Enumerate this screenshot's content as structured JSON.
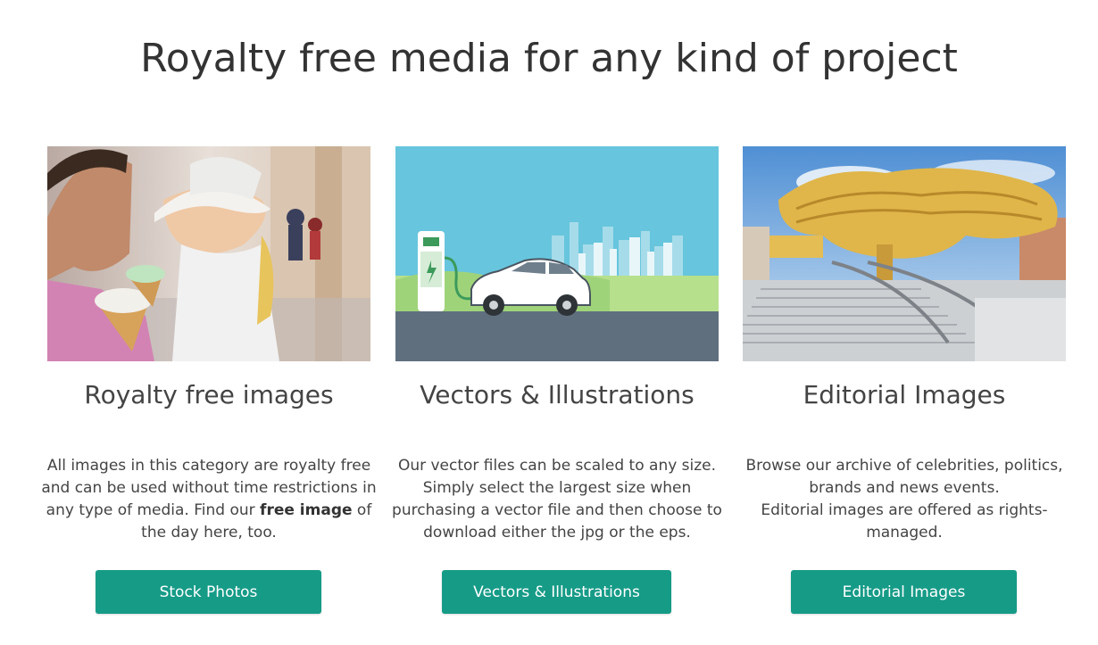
{
  "page": {
    "title": "Royalty free media for any kind of project"
  },
  "cards": [
    {
      "image_subject": "smiling couple holding ice cream cones",
      "title": "Royalty free images",
      "description_before": "All images in this category are royalty free and can be used without time restrictions in any type of media. Find our ",
      "description_bold": "free image",
      "description_after": " of the day here, too.",
      "button_label": "Stock Photos"
    },
    {
      "image_subject": "electric car at charging station illustration",
      "title": "Vectors & Illustrations",
      "description": "Our vector files can be scaled to any size. Simply select the largest size when purchasing a vector file and then choose to download either the jpg or the eps.",
      "button_label": "Vectors & Illustrations"
    },
    {
      "image_subject": "wooden canopy architecture with stairs",
      "title": "Editorial Images",
      "description_line1": "Browse our archive of celebrities, politics, brands and news events.",
      "description_line2": "Editorial images are offered as rights-managed.",
      "button_label": "Editorial Images"
    }
  ],
  "colors": {
    "button_bg": "#169b87",
    "button_text": "#ffffff",
    "title_text": "#333333",
    "body_text": "#444444"
  }
}
